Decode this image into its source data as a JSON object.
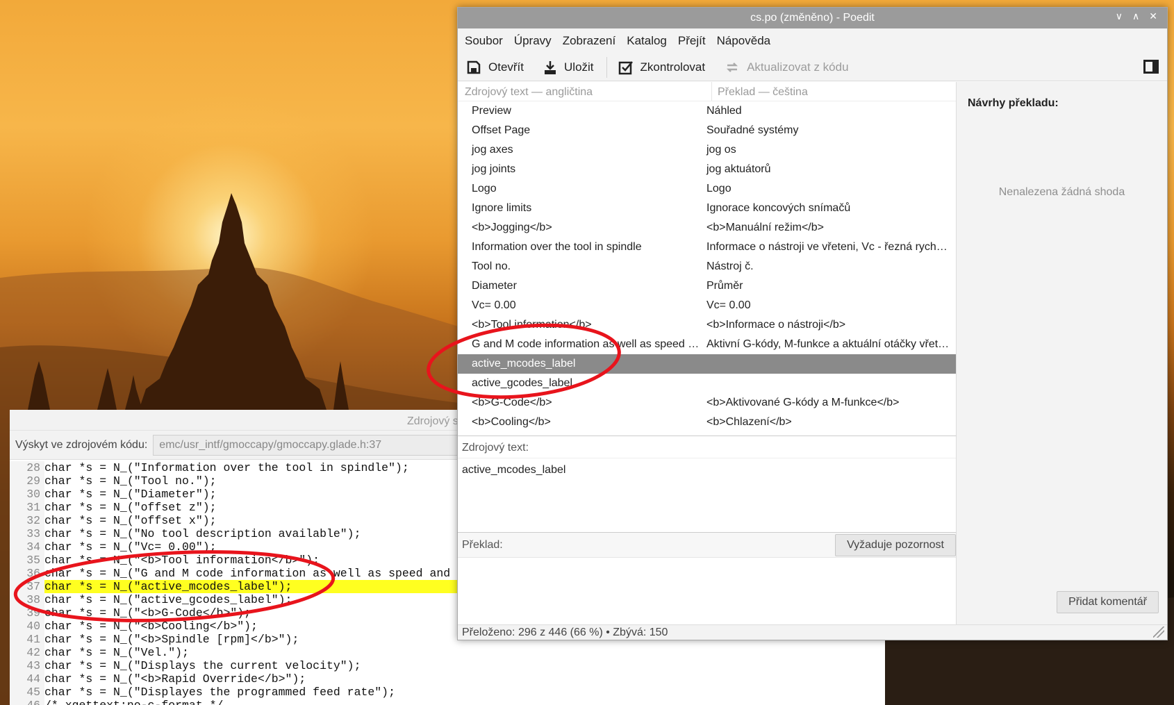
{
  "poedit": {
    "title": "cs.po (změněno) - Poedit",
    "window_controls": [
      "∨",
      "∧",
      "✕"
    ],
    "menu": [
      "Soubor",
      "Úpravy",
      "Zobrazení",
      "Katalog",
      "Přejít",
      "Nápověda"
    ],
    "toolbar": {
      "open": "Otevřít",
      "save": "Uložit",
      "check": "Zkontrolovat",
      "update": "Aktualizovat z kódu"
    },
    "list_header": {
      "source": "Zdrojový text — angličtina",
      "translation": "Překlad — čeština"
    },
    "rows": [
      {
        "src": "Preview",
        "tr": "Náhled"
      },
      {
        "src": "Offset Page",
        "tr": "Souřadné systémy"
      },
      {
        "src": "jog axes",
        "tr": "jog os"
      },
      {
        "src": "jog joints",
        "tr": "jog aktuátorů"
      },
      {
        "src": "Logo",
        "tr": "Logo"
      },
      {
        "src": "Ignore limits",
        "tr": "Ignorace koncových snímačů"
      },
      {
        "src": "<b>Jogging</b>",
        "tr": "<b>Manuální režim</b>"
      },
      {
        "src": "Information over the tool in spindle",
        "tr": "Informace o nástroji ve vřeteni, Vc - řezná rychl…"
      },
      {
        "src": "Tool no.",
        "tr": "Nástroj č."
      },
      {
        "src": "Diameter",
        "tr": "Průměr"
      },
      {
        "src": "Vc= 0.00",
        "tr": "Vc= 0.00"
      },
      {
        "src": "<b>Tool information</b>",
        "tr": "<b>Informace o nástroji</b>"
      },
      {
        "src": "G and M code information as well as speed an…",
        "tr": "Aktivní G-kódy, M-funkce a aktuální otáčky vřet…"
      },
      {
        "src": "active_mcodes_label",
        "tr": ""
      },
      {
        "src": "active_gcodes_label",
        "tr": ""
      },
      {
        "src": "<b>G-Code</b>",
        "tr": "<b>Aktivované G-kódy a M-funkce</b>"
      },
      {
        "src": "<b>Cooling</b>",
        "tr": "<b>Chlazení</b>"
      }
    ],
    "selected_index": 13,
    "source_label": "Zdrojový text:",
    "source_value": "active_mcodes_label",
    "translation_label": "Překlad:",
    "needs_work_button": "Vyžaduje pozornost",
    "suggestions_title": "Návrhy překladu:",
    "no_match": "Nenalezena žádná shoda",
    "add_comment_button": "Přidat komentář",
    "status": "Přeloženo: 296 z 446 (66 %)  •  Zbývá: 150"
  },
  "source_viewer": {
    "title": "Zdrojový s",
    "location_label": "Výskyt ve zdrojovém kódu:",
    "location_value": "emc/usr_intf/gmoccapy/gmoccapy.glade.h:37",
    "highlight_line": 37,
    "lines": [
      {
        "n": "28",
        "t": "char *s = N_(\"Information over the tool in spindle\");"
      },
      {
        "n": "29",
        "t": "char *s = N_(\"Tool no.\");"
      },
      {
        "n": "30",
        "t": "char *s = N_(\"Diameter\");"
      },
      {
        "n": "31",
        "t": "char *s = N_(\"offset z\");"
      },
      {
        "n": "32",
        "t": "char *s = N_(\"offset x\");"
      },
      {
        "n": "33",
        "t": "char *s = N_(\"No tool description available\");"
      },
      {
        "n": "34",
        "t": "char *s = N_(\"Vc= 0.00\");"
      },
      {
        "n": "35",
        "t": "char *s = N_(\"<b>Tool information</b>\");"
      },
      {
        "n": "36",
        "t": "char *s = N_(\"G and M code information as well as speed and"
      },
      {
        "n": "37",
        "t": "char *s = N_(\"active_mcodes_label\");"
      },
      {
        "n": "38",
        "t": "char *s = N_(\"active_gcodes_label\");"
      },
      {
        "n": "39",
        "t": "char *s = N_(\"<b>G-Code</b>\");"
      },
      {
        "n": "40",
        "t": "char *s = N_(\"<b>Cooling</b>\");"
      },
      {
        "n": "41",
        "t": "char *s = N_(\"<b>Spindle [rpm]</b>\");"
      },
      {
        "n": "42",
        "t": "char *s = N_(\"Vel.\");"
      },
      {
        "n": "43",
        "t": "char *s = N_(\"Displays the current velocity\");"
      },
      {
        "n": "44",
        "t": "char *s = N_(\"<b>Rapid Override</b>\");"
      },
      {
        "n": "45",
        "t": "char *s = N_(\"Displayes the programmed feed rate\");"
      },
      {
        "n": "46",
        "t": "/* xgettext:no-c-format */"
      }
    ]
  },
  "colors": {
    "selection": "#8a8a8a",
    "highlight": "#ffff20",
    "annotation": "#e8141c",
    "titlebar": "#9b9b9b"
  }
}
